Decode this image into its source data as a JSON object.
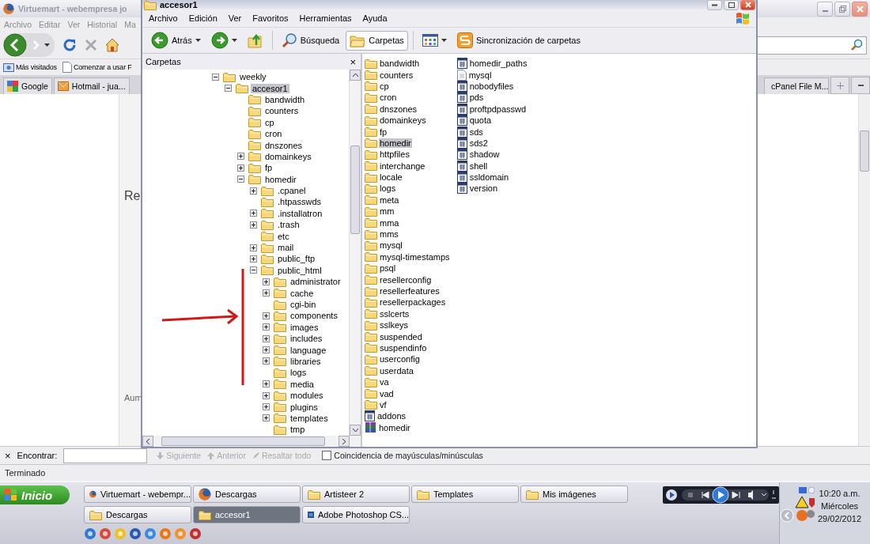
{
  "browser": {
    "title": "Virtuemart - webempresa jo",
    "menu": [
      "Archivo",
      "Editar",
      "Ver",
      "Historial",
      "Ma"
    ],
    "bookmarks": [
      "Más visitados",
      "Comenzar a usar F"
    ],
    "tabs_left": [
      {
        "label": "Google",
        "selected": false
      },
      {
        "label": "Hotmail - jua...",
        "selected": false
      }
    ],
    "tabs_right": [
      {
        "label": "cPanel File M...",
        "selected": false
      }
    ],
    "page_fragments": [
      "Re",
      "Aum"
    ],
    "find_bar": {
      "close": "×",
      "label": "Encontrar:",
      "buttons": [
        {
          "label": "Siguiente",
          "disabled": true
        },
        {
          "label": "Anterior",
          "disabled": true
        },
        {
          "label": "Resaltar todo",
          "disabled": true
        }
      ],
      "match_case": {
        "label": "Coincidencia de mayúsculas/minúsculas",
        "checked": false
      }
    },
    "status": "Terminado"
  },
  "explorer": {
    "title": "accesor1",
    "menu": [
      "Archivo",
      "Edición",
      "Ver",
      "Favoritos",
      "Herramientas",
      "Ayuda"
    ],
    "toolbar": [
      {
        "kind": "back",
        "label": "Atrás",
        "pressed": false
      },
      {
        "kind": "forward",
        "pressed": false
      },
      {
        "kind": "up",
        "pressed": false
      },
      {
        "kind": "search",
        "label": "Búsqueda",
        "pressed": false
      },
      {
        "kind": "folders",
        "label": "Carpetas",
        "pressed": true
      },
      {
        "kind": "views",
        "pressed": false
      },
      {
        "kind": "sync",
        "label": "Sincronización de carpetas",
        "pressed": false
      }
    ],
    "folders_pane": {
      "title": "Carpetas",
      "close": "×",
      "tree": [
        {
          "label": "weekly",
          "kind": "expanded",
          "selected": false,
          "children": [
            {
              "label": "accesor1",
              "kind": "expanded",
              "selected": true,
              "children": [
                {
                  "label": "bandwidth",
                  "kind": "leaf",
                  "selected": false
                },
                {
                  "label": "counters",
                  "kind": "leaf",
                  "selected": false
                },
                {
                  "label": "cp",
                  "kind": "leaf",
                  "selected": false
                },
                {
                  "label": "cron",
                  "kind": "leaf",
                  "selected": false
                },
                {
                  "label": "dnszones",
                  "kind": "leaf",
                  "selected": false
                },
                {
                  "label": "domainkeys",
                  "kind": "collapsed",
                  "selected": false
                },
                {
                  "label": "fp",
                  "kind": "collapsed",
                  "selected": false
                },
                {
                  "label": "homedir",
                  "kind": "expanded",
                  "selected": false,
                  "children": [
                    {
                      "label": ".cpanel",
                      "kind": "collapsed",
                      "selected": false
                    },
                    {
                      "label": ".htpasswds",
                      "kind": "leaf",
                      "selected": false
                    },
                    {
                      "label": ".installatron",
                      "kind": "collapsed",
                      "selected": false
                    },
                    {
                      "label": ".trash",
                      "kind": "collapsed",
                      "selected": false
                    },
                    {
                      "label": "etc",
                      "kind": "leaf",
                      "selected": false
                    },
                    {
                      "label": "mail",
                      "kind": "collapsed",
                      "selected": false
                    },
                    {
                      "label": "public_ftp",
                      "kind": "collapsed",
                      "selected": false
                    },
                    {
                      "label": "public_html",
                      "kind": "expanded",
                      "selected": false,
                      "children": [
                        {
                          "label": "administrator",
                          "kind": "collapsed",
                          "selected": false
                        },
                        {
                          "label": "cache",
                          "kind": "collapsed",
                          "selected": false
                        },
                        {
                          "label": "cgi-bin",
                          "kind": "leaf",
                          "selected": false
                        },
                        {
                          "label": "components",
                          "kind": "collapsed",
                          "selected": false
                        },
                        {
                          "label": "images",
                          "kind": "collapsed",
                          "selected": false
                        },
                        {
                          "label": "includes",
                          "kind": "collapsed",
                          "selected": false
                        },
                        {
                          "label": "language",
                          "kind": "collapsed",
                          "selected": false
                        },
                        {
                          "label": "libraries",
                          "kind": "collapsed",
                          "selected": false
                        },
                        {
                          "label": "logs",
                          "kind": "leaf",
                          "selected": false
                        },
                        {
                          "label": "media",
                          "kind": "collapsed",
                          "selected": false
                        },
                        {
                          "label": "modules",
                          "kind": "collapsed",
                          "selected": false
                        },
                        {
                          "label": "plugins",
                          "kind": "collapsed",
                          "selected": false
                        },
                        {
                          "label": "templates",
                          "kind": "collapsed",
                          "selected": false
                        },
                        {
                          "label": "tmp",
                          "kind": "leaf",
                          "selected": false
                        }
                      ]
                    }
                  ]
                }
              ]
            }
          ]
        }
      ]
    },
    "files": [
      {
        "name": "bandwidth",
        "kind": "folder",
        "selected": false
      },
      {
        "name": "counters",
        "kind": "folder",
        "selected": false
      },
      {
        "name": "cp",
        "kind": "folder",
        "selected": false
      },
      {
        "name": "cron",
        "kind": "folder",
        "selected": false
      },
      {
        "name": "dnszones",
        "kind": "folder",
        "selected": false
      },
      {
        "name": "domainkeys",
        "kind": "folder",
        "selected": false
      },
      {
        "name": "fp",
        "kind": "folder",
        "selected": false
      },
      {
        "name": "homedir",
        "kind": "folder",
        "selected": true
      },
      {
        "name": "httpfiles",
        "kind": "folder",
        "selected": false
      },
      {
        "name": "interchange",
        "kind": "folder",
        "selected": false
      },
      {
        "name": "locale",
        "kind": "folder",
        "selected": false
      },
      {
        "name": "logs",
        "kind": "folder",
        "selected": false
      },
      {
        "name": "meta",
        "kind": "folder",
        "selected": false
      },
      {
        "name": "mm",
        "kind": "folder",
        "selected": false
      },
      {
        "name": "mma",
        "kind": "folder",
        "selected": false
      },
      {
        "name": "mms",
        "kind": "folder",
        "selected": false
      },
      {
        "name": "mysql",
        "kind": "folder",
        "selected": false
      },
      {
        "name": "mysql-timestamps",
        "kind": "folder",
        "selected": false
      },
      {
        "name": "psql",
        "kind": "folder",
        "selected": false
      },
      {
        "name": "resellerconfig",
        "kind": "folder",
        "selected": false
      },
      {
        "name": "resellerfeatures",
        "kind": "folder",
        "selected": false
      },
      {
        "name": "resellerpackages",
        "kind": "folder",
        "selected": false
      },
      {
        "name": "sslcerts",
        "kind": "folder",
        "selected": false
      },
      {
        "name": "sslkeys",
        "kind": "folder",
        "selected": false
      },
      {
        "name": "suspended",
        "kind": "folder",
        "selected": false
      },
      {
        "name": "suspendinfo",
        "kind": "folder",
        "selected": false
      },
      {
        "name": "userconfig",
        "kind": "folder",
        "selected": false
      },
      {
        "name": "userdata",
        "kind": "folder",
        "selected": false
      },
      {
        "name": "va",
        "kind": "folder",
        "selected": false
      },
      {
        "name": "vad",
        "kind": "folder",
        "selected": false
      },
      {
        "name": "vf",
        "kind": "folder",
        "selected": false
      },
      {
        "name": "addons",
        "kind": "file",
        "selected": false
      },
      {
        "name": "homedir",
        "kind": "archive",
        "selected": false
      },
      {
        "name": "homedir_paths",
        "kind": "file",
        "selected": false
      },
      {
        "name": "mysql",
        "kind": "text",
        "selected": false
      },
      {
        "name": "nobodyfiles",
        "kind": "file",
        "selected": false
      },
      {
        "name": "pds",
        "kind": "file",
        "selected": false
      },
      {
        "name": "proftpdpasswd",
        "kind": "file",
        "selected": false
      },
      {
        "name": "quota",
        "kind": "file",
        "selected": false
      },
      {
        "name": "sds",
        "kind": "file",
        "selected": false
      },
      {
        "name": "sds2",
        "kind": "file",
        "selected": false
      },
      {
        "name": "shadow",
        "kind": "file",
        "selected": false
      },
      {
        "name": "shell",
        "kind": "file",
        "selected": false
      },
      {
        "name": "ssldomain",
        "kind": "file",
        "selected": false
      },
      {
        "name": "version",
        "kind": "file",
        "selected": false
      }
    ]
  },
  "taskbar": {
    "start": "Inicio",
    "tasks": [
      {
        "label": "Virtuemart - webempr...",
        "kind": "firefox",
        "selected": false
      },
      {
        "label": "Descargas",
        "kind": "firefox",
        "selected": false
      },
      {
        "label": "Artisteer 2",
        "kind": "folder",
        "selected": false
      },
      {
        "label": "Templates",
        "kind": "folder",
        "selected": false
      },
      {
        "label": "Mis imágenes",
        "kind": "folder",
        "selected": false
      },
      {
        "label": "Descargas",
        "kind": "folder",
        "selected": false
      },
      {
        "label": "accesor1",
        "kind": "folder",
        "selected": true
      },
      {
        "label": "Adobe Photoshop CS...",
        "kind": "photoshop",
        "selected": false
      }
    ],
    "clock": {
      "time": "10:20 a.m.",
      "day": "Miércoles",
      "date": "29/02/2012"
    }
  }
}
